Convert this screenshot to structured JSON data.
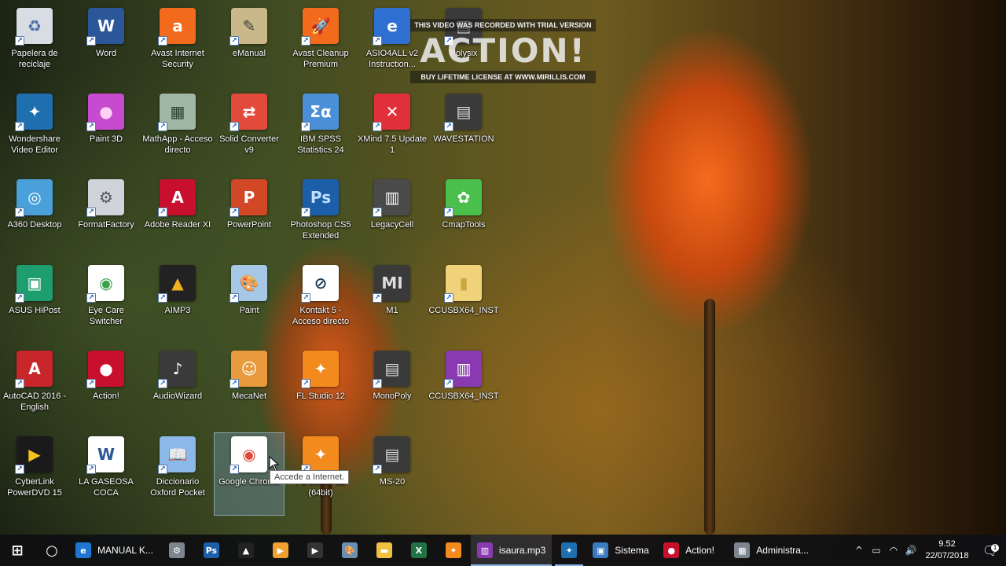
{
  "watermark": {
    "top": "THIS VIDEO WAS RECORDED WITH TRIAL VERSION",
    "logo": "ACTION!",
    "bottom": "BUY LIFETIME LICENSE AT WWW.MIRILLIS.COM"
  },
  "desktop_icons": [
    {
      "label": "Papelera de reciclaje",
      "name": "recycle-bin",
      "glyph": "♻",
      "bg": "#d8dde4",
      "fg": "#4a6fa5"
    },
    {
      "label": "Word",
      "name": "word",
      "glyph": "W",
      "bg": "#2b579a",
      "fg": "#ffffff"
    },
    {
      "label": "Avast Internet Security",
      "name": "avast-internet-security",
      "glyph": "a",
      "bg": "#f26b1d",
      "fg": "#ffffff"
    },
    {
      "label": "eManual",
      "name": "emanual",
      "glyph": "✎",
      "bg": "#c9b98a",
      "fg": "#3c3c3c"
    },
    {
      "label": "Avast Cleanup Premium",
      "name": "avast-cleanup-premium",
      "glyph": "🚀",
      "bg": "#f26b1d",
      "fg": "#ffffff"
    },
    {
      "label": "ASIO4ALL v2 Instruction...",
      "name": "asio4all-instructions",
      "glyph": "e",
      "bg": "#2f6fd1",
      "fg": "#ffffff"
    },
    {
      "label": "Polysix",
      "name": "polysix",
      "glyph": "▤",
      "bg": "#3a3a3a",
      "fg": "#dddddd"
    },
    {
      "label": "Wondershare Video Editor",
      "name": "wondershare-video-editor",
      "glyph": "✦",
      "bg": "#1d6fb0",
      "fg": "#ffffff"
    },
    {
      "label": "Paint 3D",
      "name": "paint-3d",
      "glyph": "●",
      "bg": "#c64bcf",
      "fg": "#ffd1f5"
    },
    {
      "label": "MathApp - Acceso directo",
      "name": "mathapp",
      "glyph": "▦",
      "bg": "#9fb8a6",
      "fg": "#2c4030"
    },
    {
      "label": "Solid Converter v9",
      "name": "solid-converter",
      "glyph": "⇄",
      "bg": "#e24b3b",
      "fg": "#ffffff"
    },
    {
      "label": "IBM SPSS Statistics 24",
      "name": "ibm-spss",
      "glyph": "Σα",
      "bg": "#4a8fd8",
      "fg": "#ffffff"
    },
    {
      "label": "XMind 7.5 Update 1",
      "name": "xmind",
      "glyph": "✕",
      "bg": "#e0303a",
      "fg": "#ffffff"
    },
    {
      "label": "WAVESTATION",
      "name": "wavestation",
      "glyph": "▤",
      "bg": "#3a3a3a",
      "fg": "#dddddd"
    },
    {
      "label": "A360 Desktop",
      "name": "a360-desktop",
      "glyph": "◎",
      "bg": "#4aa0d8",
      "fg": "#ffffff"
    },
    {
      "label": "FormatFactory",
      "name": "formatfactory",
      "glyph": "⚙",
      "bg": "#d0d4da",
      "fg": "#555555"
    },
    {
      "label": "Adobe Reader XI",
      "name": "adobe-reader",
      "glyph": "A",
      "bg": "#c8102e",
      "fg": "#ffffff"
    },
    {
      "label": "PowerPoint",
      "name": "powerpoint",
      "glyph": "P",
      "bg": "#d24726",
      "fg": "#ffffff"
    },
    {
      "label": "Photoshop CS5 Extended",
      "name": "photoshop-cs5",
      "glyph": "Ps",
      "bg": "#1c5fa8",
      "fg": "#bfe0ff"
    },
    {
      "label": "LegacyCell",
      "name": "legacycell",
      "glyph": "▥",
      "bg": "#4a4a4a",
      "fg": "#ffffff"
    },
    {
      "label": "CmapTools",
      "name": "cmaptools",
      "glyph": "✿",
      "bg": "#4bbf4b",
      "fg": "#ffffff"
    },
    {
      "label": "ASUS HiPost",
      "name": "asus-hipost",
      "glyph": "▣",
      "bg": "#1e9e6e",
      "fg": "#ffffff"
    },
    {
      "label": "Eye Care Switcher",
      "name": "eye-care-switcher",
      "glyph": "◉",
      "bg": "#ffffff",
      "fg": "#3aa04a"
    },
    {
      "label": "AIMP3",
      "name": "aimp3",
      "glyph": "▲",
      "bg": "#222222",
      "fg": "#f2b01e"
    },
    {
      "label": "Paint",
      "name": "paint",
      "glyph": "🎨",
      "bg": "#a7c7e7",
      "fg": "#ffffff"
    },
    {
      "label": "Kontakt 5 - Acceso directo",
      "name": "kontakt-5",
      "glyph": "⊘",
      "bg": "#ffffff",
      "fg": "#1a3a5a"
    },
    {
      "label": "M1",
      "name": "m1",
      "glyph": "MI",
      "bg": "#3a3a3a",
      "fg": "#dddddd"
    },
    {
      "label": "CCUSBX64_INST",
      "name": "ccusbx64-inst-folder",
      "glyph": "▮",
      "bg": "#f0d27a",
      "fg": "#c9a740"
    },
    {
      "label": "AutoCAD 2016 - English",
      "name": "autocad-2016",
      "glyph": "A",
      "bg": "#c9262b",
      "fg": "#ffffff"
    },
    {
      "label": "Action!",
      "name": "action-app",
      "glyph": "●",
      "bg": "#c8102e",
      "fg": "#ffffff"
    },
    {
      "label": "AudioWizard",
      "name": "audiowizard",
      "glyph": "♪",
      "bg": "#3a3a3a",
      "fg": "#ffffff"
    },
    {
      "label": "MecaNet",
      "name": "mecanet",
      "glyph": "☺",
      "bg": "#e89a3c",
      "fg": "#ffffff"
    },
    {
      "label": "FL Studio 12",
      "name": "fl-studio-12",
      "glyph": "✦",
      "bg": "#f28a1e",
      "fg": "#ffffff"
    },
    {
      "label": "MonoPoly",
      "name": "monopoly",
      "glyph": "▤",
      "bg": "#3a3a3a",
      "fg": "#dddddd"
    },
    {
      "label": "CCUSBX64_INST",
      "name": "ccusbx64-inst-archive",
      "glyph": "▥",
      "bg": "#8a3ab0",
      "fg": "#ffffff"
    },
    {
      "label": "CyberLink PowerDVD 15",
      "name": "cyberlink-powerdvd",
      "glyph": "▶",
      "bg": "#1a1a1a",
      "fg": "#f2c21e"
    },
    {
      "label": "LA GASEOSA COCA",
      "name": "la-gaseosa-coca",
      "glyph": "W",
      "bg": "#ffffff",
      "fg": "#2b579a"
    },
    {
      "label": "Diccionario Oxford Pocket",
      "name": "diccionario-oxford",
      "glyph": "📖",
      "bg": "#8ab8e8",
      "fg": "#ffffff"
    },
    {
      "label": "Google Chrome",
      "name": "google-chrome",
      "glyph": "◉",
      "bg": "#ffffff",
      "fg": "#dd4b39"
    },
    {
      "label": "FL Studio 12 (64bit)",
      "name": "fl-studio-12-64bit",
      "glyph": "✦",
      "bg": "#f28a1e",
      "fg": "#ffffff"
    },
    {
      "label": "MS-20",
      "name": "ms-20",
      "glyph": "▤",
      "bg": "#3a3a3a",
      "fg": "#dddddd"
    }
  ],
  "tooltip": "Accede a Internet.",
  "taskbar": {
    "items": [
      {
        "name": "start-button",
        "type": "sq",
        "glyph": "⊞",
        "bg": "transparent"
      },
      {
        "name": "cortana-button",
        "type": "sq",
        "glyph": "○",
        "bg": "transparent"
      },
      {
        "name": "taskbar-edge",
        "type": "wide",
        "glyph": "e",
        "bg": "#1e76d2",
        "label": "MANUAL K..."
      },
      {
        "name": "taskbar-formatfactory",
        "type": "sq",
        "glyph": "⚙",
        "bg": "#7d8590"
      },
      {
        "name": "taskbar-photoshop",
        "type": "sq",
        "glyph": "Ps",
        "bg": "#1c5fa8"
      },
      {
        "name": "taskbar-aimp",
        "type": "sq",
        "glyph": "▲",
        "bg": "#222222"
      },
      {
        "name": "taskbar-media",
        "type": "sq",
        "glyph": "▶",
        "bg": "#f0a030"
      },
      {
        "name": "taskbar-powerdvd",
        "type": "sq",
        "glyph": "▶",
        "bg": "#333333"
      },
      {
        "name": "taskbar-paint",
        "type": "sq",
        "glyph": "🎨",
        "bg": "#6a8fb5"
      },
      {
        "name": "taskbar-explorer",
        "type": "sq",
        "glyph": "▬",
        "bg": "#f0c040"
      },
      {
        "name": "taskbar-excel",
        "type": "sq",
        "glyph": "X",
        "bg": "#217346"
      },
      {
        "name": "taskbar-fl-studio",
        "type": "sq",
        "glyph": "✦",
        "bg": "#f28a1e"
      },
      {
        "name": "taskbar-winrar",
        "type": "wide",
        "glyph": "▥",
        "bg": "#8a3ab0",
        "label": "isaura.mp3",
        "active": true
      },
      {
        "name": "taskbar-wondershare",
        "type": "sq",
        "glyph": "✦",
        "bg": "#1d6fb0",
        "active": true
      },
      {
        "name": "taskbar-sistema",
        "type": "wide",
        "glyph": "▣",
        "bg": "#3a7ac0",
        "label": "Sistema"
      },
      {
        "name": "taskbar-action",
        "type": "wide",
        "glyph": "●",
        "bg": "#c8102e",
        "label": "Action!"
      },
      {
        "name": "taskbar-administrador",
        "type": "wide",
        "glyph": "▦",
        "bg": "#7d8590",
        "label": "Administra..."
      }
    ],
    "tray": {
      "chevron": "^",
      "battery": "▭",
      "network": "◠",
      "volume": "🔊",
      "time": "9.52",
      "date": "22/07/2018",
      "notification_glyph": "🗨",
      "notification_count": "1"
    }
  }
}
